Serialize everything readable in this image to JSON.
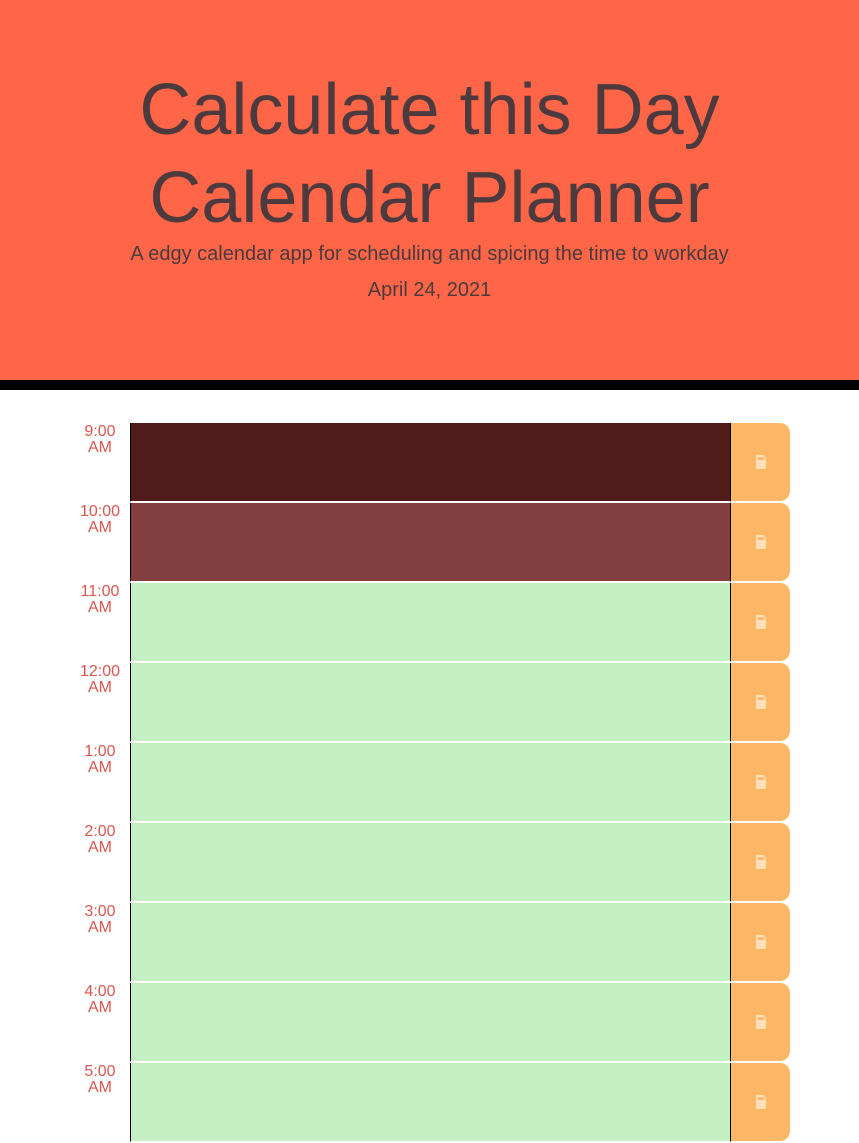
{
  "header": {
    "title_line1": "Calculate this Day",
    "title_line2": "Calendar Planner",
    "lead": "A edgy calendar app for scheduling and spicing the time to workday",
    "current_day": "April 24, 2021"
  },
  "colors": {
    "header_bg": "#ff6647",
    "past": "#521b1b",
    "present": "#833f3f",
    "future": "#c4efc3",
    "save_button": "#fdb767",
    "hour_text": "#d9574f"
  },
  "save_icon": "save-icon",
  "rows": [
    {
      "hour": "9:00",
      "ampm": "AM",
      "state": "past",
      "text": ""
    },
    {
      "hour": "10:00",
      "ampm": "AM",
      "state": "present",
      "text": ""
    },
    {
      "hour": "11:00",
      "ampm": "AM",
      "state": "future",
      "text": ""
    },
    {
      "hour": "12:00",
      "ampm": "AM",
      "state": "future",
      "text": ""
    },
    {
      "hour": "1:00",
      "ampm": "AM",
      "state": "future",
      "text": ""
    },
    {
      "hour": "2:00",
      "ampm": "AM",
      "state": "future",
      "text": ""
    },
    {
      "hour": "3:00",
      "ampm": "AM",
      "state": "future",
      "text": ""
    },
    {
      "hour": "4:00",
      "ampm": "AM",
      "state": "future",
      "text": ""
    },
    {
      "hour": "5:00",
      "ampm": "AM",
      "state": "future",
      "text": ""
    }
  ]
}
